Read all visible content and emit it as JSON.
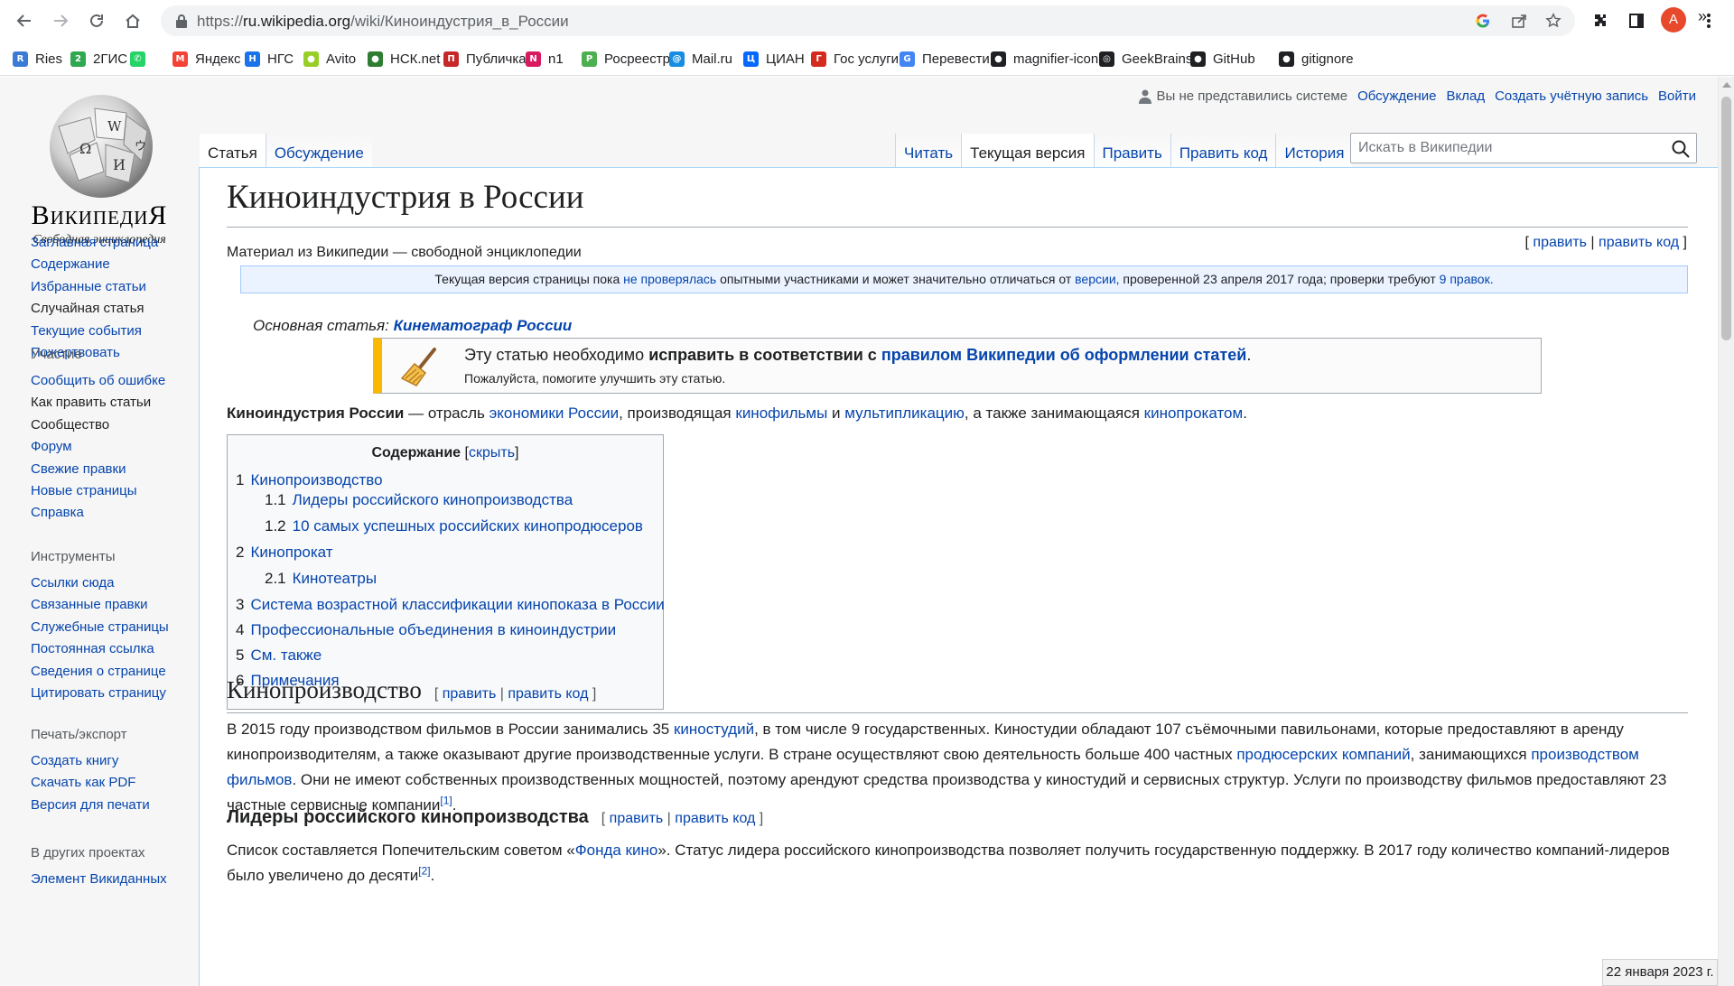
{
  "browser": {
    "url_scheme": "https://",
    "url_host": "ru.wikipedia.org",
    "url_path": "/wiki/Киноиндустрия_в_России",
    "profile_letter": "A"
  },
  "bookmarks": [
    {
      "label": "Ries",
      "icon": "ries-icon",
      "color": "#3a7bd5"
    },
    {
      "label": "2ГИС",
      "icon": "2gis-icon",
      "color": "#2fa84f"
    },
    {
      "label": "",
      "icon": "whatsapp-icon",
      "color": "#25d366"
    },
    {
      "label": "Яндекс",
      "icon": "yandex-mail-icon",
      "color": "#f44336"
    },
    {
      "label": "НГС",
      "icon": "ngs-icon",
      "color": "#1a73e8"
    },
    {
      "label": "Avito",
      "icon": "avito-icon",
      "color": "#97cf26"
    },
    {
      "label": "НСК.net",
      "icon": "nsknet-icon",
      "color": "#2e7d32"
    },
    {
      "label": "Публичка",
      "icon": "publichka-icon",
      "color": "#c62828"
    },
    {
      "label": "n1",
      "icon": "n1-icon",
      "color": "#d81b60"
    },
    {
      "label": "Росреестр",
      "icon": "rosreestr-icon",
      "color": "#4caf50"
    },
    {
      "label": "Mail.ru",
      "icon": "mailru-icon",
      "color": "#168de2"
    },
    {
      "label": "ЦИАН",
      "icon": "cian-icon",
      "color": "#0468ff"
    },
    {
      "label": "Гос услуги",
      "icon": "gosuslugi-icon",
      "color": "#d52b1e"
    },
    {
      "label": "Перевести",
      "icon": "translate-icon",
      "color": "#4285f4"
    },
    {
      "label": "magnifier-icon",
      "icon": "magnifier-site-icon",
      "color": "#202124"
    },
    {
      "label": "GeekBrains",
      "icon": "geekbrains-icon",
      "color": "#202124"
    },
    {
      "label": "GitHub",
      "icon": "github-icon",
      "color": "#202124"
    },
    {
      "label": "gitignore",
      "icon": "github-icon",
      "color": "#202124"
    }
  ],
  "bookmarks_more": "»",
  "logo": {
    "wordmark": "ВикипедиЯ",
    "tagline": "Свободная энциклопедия"
  },
  "personal_tools": {
    "not_logged": "Вы не представились системе",
    "talk": "Обсуждение",
    "contributions": "Вклад",
    "create_account": "Создать учётную запись",
    "login": "Войти"
  },
  "tabs": {
    "left": [
      "Статья",
      "Обсуждение"
    ],
    "right": [
      "Читать",
      "Текущая версия",
      "Править",
      "Править код",
      "История"
    ],
    "left_selected": 0,
    "right_selected": 1
  },
  "search": {
    "placeholder": "Искать в Википедии"
  },
  "sidebar": {
    "nav": [
      "Заглавная страница",
      "Содержание",
      "Избранные статьи",
      "Случайная статья",
      "Текущие события",
      "Пожертвовать"
    ],
    "sections": [
      {
        "title": "Участие",
        "items": [
          "Сообщить об ошибке",
          "Как править статьи",
          "Сообщество",
          "Форум",
          "Свежие правки",
          "Новые страницы",
          "Справка"
        ]
      },
      {
        "title": "Инструменты",
        "items": [
          "Ссылки сюда",
          "Связанные правки",
          "Служебные страницы",
          "Постоянная ссылка",
          "Сведения о странице",
          "Цитировать страницу"
        ]
      },
      {
        "title": "Печать/экспорт",
        "items": [
          "Создать книгу",
          "Скачать как PDF",
          "Версия для печати"
        ]
      },
      {
        "title": "В других проектах",
        "items": [
          "Элемент Викиданных"
        ]
      }
    ]
  },
  "article": {
    "title": "Киноиндустрия в России",
    "site_sub": "Материал из Википедии — свободной энциклопедии",
    "edit": "править",
    "edit_code": "править код",
    "review": {
      "t1": "Текущая версия страницы пока ",
      "l1": "не проверялась",
      "t2": " опытными участниками и может значительно отличаться от ",
      "l2": "версии,",
      "t3": " проверенной 23 апреля 2017 года; проверки требуют ",
      "l3": "9 правок."
    },
    "main_article_label": "Основная статья: ",
    "main_article_link": "Кинематограф России",
    "ambox": {
      "t1": "Эту статью необходимо ",
      "b1": "исправить в соответствии с ",
      "l1": "правилом Википедии об оформлении статей",
      "t2": ".",
      "line2": "Пожалуйста, помогите улучшить эту статью."
    },
    "intro": {
      "b": "Киноиндустрия России",
      "t1": " — отрасль ",
      "l1": "экономики России",
      "t2": ", производящая ",
      "l2": "кинофильмы",
      "t3": " и ",
      "l3": "мультипликацию",
      "t4": ", а также занимающаяся ",
      "l4": "кинопрокатом",
      "t5": "."
    },
    "toc": {
      "title": "Содержание",
      "toggle": "скрыть",
      "entries": [
        {
          "num": "1",
          "text": "Кинопроизводство",
          "level": 1
        },
        {
          "num": "1.1",
          "text": "Лидеры российского кинопроизводства",
          "level": 2
        },
        {
          "num": "1.2",
          "text": "10 самых успешных российских кинопродюсеров",
          "level": 2
        },
        {
          "num": "2",
          "text": "Кинопрокат",
          "level": 1
        },
        {
          "num": "2.1",
          "text": "Кинотеатры",
          "level": 2
        },
        {
          "num": "3",
          "text": "Система возрастной классификации кинопоказа в России",
          "level": 1
        },
        {
          "num": "4",
          "text": "Профессиональные объединения в киноиндустрии",
          "level": 1
        },
        {
          "num": "5",
          "text": "См. также",
          "level": 1
        },
        {
          "num": "6",
          "text": "Примечания",
          "level": 1
        }
      ]
    },
    "section1": {
      "title": "Кинопроизводство",
      "p": {
        "t1": "В 2015 году производством фильмов в России занимались 35 ",
        "l1": "киностудий",
        "t2": ", в том числе 9 государственных. Киностудии обладают 107 съёмочными павильонами, которые предоставляют в аренду кинопроизводителям, а также оказывают другие производственные услуги. В стране осуществляют свою деятельность больше 400 частных ",
        "l2": "продюсерских компаний",
        "t3": ", занимающихся ",
        "l3": "производством фильмов",
        "t4": ". Они не имеют собственных производственных мощностей, поэтому арендуют средства производства у киностудий и сервисных структур. Услуги по производству фильмов предоставляют 23 частные сервисные компании",
        "ref": "[1]",
        "t5": "."
      }
    },
    "section2": {
      "title": "Лидеры российского кинопроизводства",
      "p": {
        "t1": "Список составляется Попечительским советом «",
        "l1": "Фонда кино",
        "t2": "». Статус лидера российского кинопроизводства позволяет получить государственную поддержку. В 2017 году количество компаний-лидеров было увеличено до десяти",
        "ref": "[2]",
        "t3": "."
      }
    }
  },
  "taskbar_date": "22 января 2023 г."
}
